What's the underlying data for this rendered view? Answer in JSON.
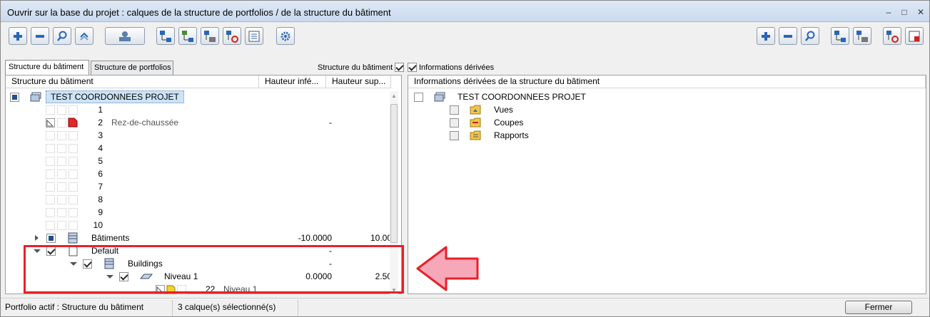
{
  "window": {
    "title": "Ouvrir sur la base du projet : calques de la structure de portfolios / de la structure du bâtiment",
    "minimize": "–",
    "maximize": "□",
    "close": "✕"
  },
  "toolbar_left": [
    "plus-icon",
    "minus-icon",
    "magnifier-icon",
    "relink-icon",
    "user-card-icon",
    "tree-add-icon",
    "tree-add-alt-icon",
    "tree-layers-icon",
    "tree-delete-icon",
    "tree-properties-icon",
    "gear-icon"
  ],
  "toolbar_right": [
    "plus-icon",
    "minus-icon",
    "magnifier-icon",
    "tree-add-icon",
    "tree-layers-icon",
    "tree-delete-icon",
    "tree-properties-icon"
  ],
  "tabs": [
    {
      "label": "Structure du bâtiment",
      "active": true
    },
    {
      "label": "Structure de portfolios",
      "active": false
    }
  ],
  "filters": {
    "structure_label": "Structure du bâtiment",
    "structure_checked": true,
    "derived_label": "Informations dérivées",
    "derived_checked": true
  },
  "left_panel": {
    "headers": [
      "Structure du bâtiment",
      "Hauteur infé...",
      "Hauteur sup..."
    ],
    "root": "TEST COORDONNEES PROJET",
    "numbered_rows": [
      {
        "num": "1",
        "name": "",
        "value": ""
      },
      {
        "num": "2",
        "name": "Rez-de-chaussée",
        "value": "-"
      },
      {
        "num": "3",
        "name": "",
        "value": ""
      },
      {
        "num": "4",
        "name": "",
        "value": ""
      },
      {
        "num": "5",
        "name": "",
        "value": ""
      },
      {
        "num": "6",
        "name": "",
        "value": ""
      },
      {
        "num": "7",
        "name": "",
        "value": ""
      },
      {
        "num": "8",
        "name": "",
        "value": ""
      },
      {
        "num": "9",
        "name": "",
        "value": ""
      },
      {
        "num": "10",
        "name": "",
        "value": ""
      }
    ],
    "batiments": {
      "label": "Bâtiments",
      "lower": "-10.0000",
      "upper": "10.00"
    },
    "default": {
      "label": "Default",
      "lower": "-"
    },
    "buildings": {
      "label": "Buildings",
      "lower": "-"
    },
    "niveau": {
      "label": "Niveau 1",
      "lower": "0.0000",
      "upper": "2.50"
    },
    "layer": {
      "num": "22",
      "name": "Niveau 1"
    }
  },
  "right_panel": {
    "header": "Informations dérivées de la structure du bâtiment",
    "root": "TEST COORDONNEES PROJET",
    "items": [
      "Vues",
      "Coupes",
      "Rapports"
    ]
  },
  "status": {
    "active_portfolio": "Portfolio actif : Structure du bâtiment",
    "selection": "3 calque(s) sélectionné(s)",
    "close_button": "Fermer"
  },
  "colors": {
    "highlight": "#e8202a",
    "arrow_fill": "#f7a8b8",
    "selected_row": "#cde3f7"
  }
}
